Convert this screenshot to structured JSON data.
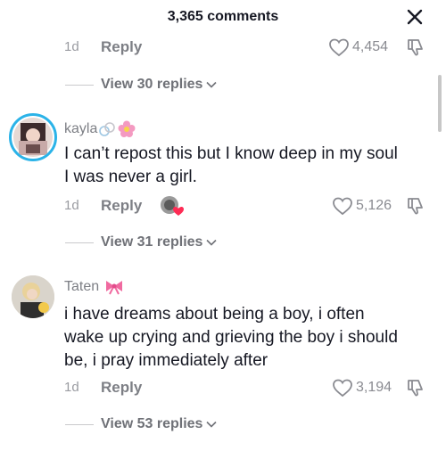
{
  "header": {
    "title": "3,365 comments"
  },
  "top_row": {
    "time": "1d",
    "reply": "Reply",
    "likes": "4,454",
    "view_replies": "View 30 replies"
  },
  "comments": [
    {
      "username": "kayla",
      "text_line1": "I can’t repost this but I know deep in my soul",
      "text_line2": "I was never a girl.",
      "time": "1d",
      "reply": "Reply",
      "likes": "5,126",
      "view_replies": "View 31 replies"
    },
    {
      "username": "Taten",
      "text_line1": "i have dreams about being a boy, i often",
      "text_line2": "wake up crying and grieving the boy i should",
      "text_line3": "be, i pray immediately after",
      "time": "1d",
      "reply": "Reply",
      "likes": "3,194",
      "view_replies": "View 53 replies"
    }
  ],
  "icons": {
    "close": "close-icon",
    "heart": "heart-icon",
    "dislike": "dislike-icon",
    "chevron": "chevron-down-icon",
    "flower": "flower-emoji",
    "bow": "bow-emoji"
  },
  "colors": {
    "avatar_ring": "#2bb3e8",
    "bow": "#f06aa0",
    "flower": "#f49ac1",
    "creator_heart": "#fe2c55"
  }
}
